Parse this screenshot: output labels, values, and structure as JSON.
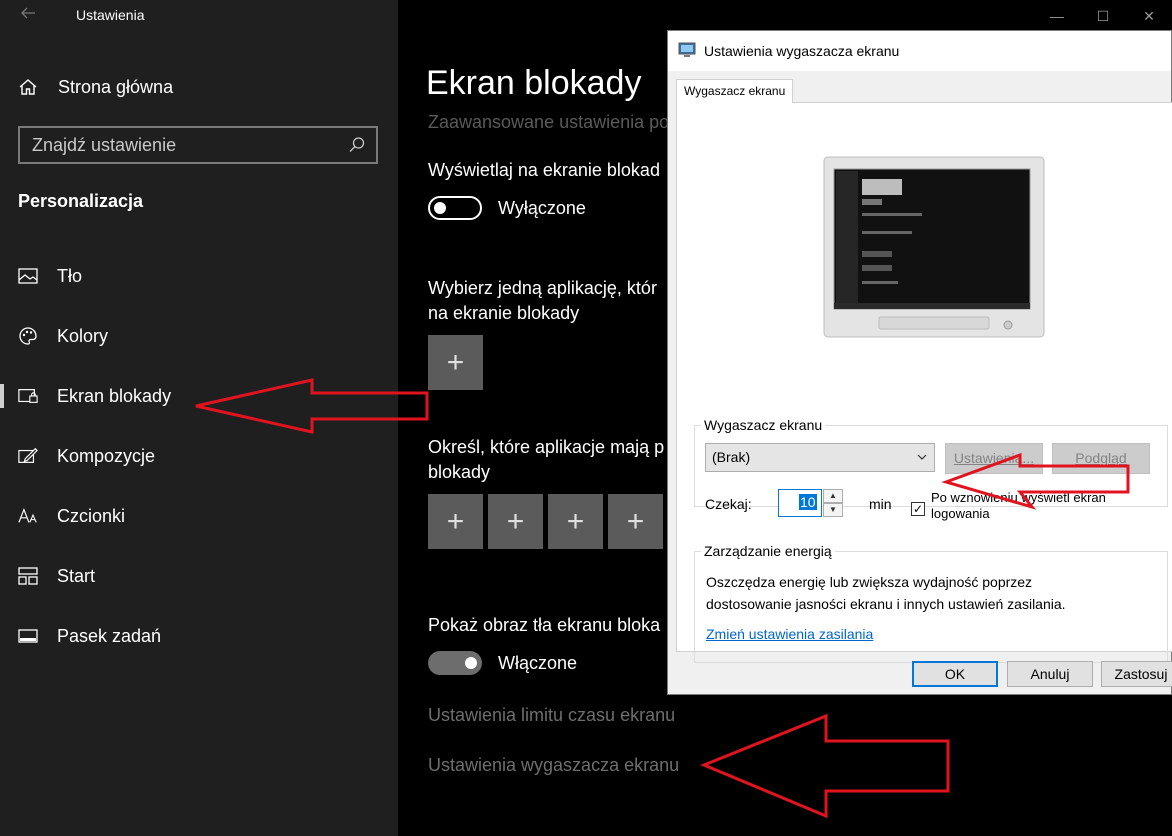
{
  "app": {
    "title": "Ustawienia"
  },
  "sidebar": {
    "home_label": "Strona główna",
    "search_placeholder": "Znajdź ustawienie",
    "section_title": "Personalizacja",
    "items": [
      {
        "label": "Tło",
        "icon": "image-icon"
      },
      {
        "label": "Kolory",
        "icon": "palette-icon"
      },
      {
        "label": "Ekran blokady",
        "icon": "lock-screen-icon",
        "active": true
      },
      {
        "label": "Kompozycje",
        "icon": "theme-brush-icon"
      },
      {
        "label": "Czcionki",
        "icon": "font-icon"
      },
      {
        "label": "Start",
        "icon": "start-icon"
      },
      {
        "label": "Pasek zadań",
        "icon": "taskbar-icon"
      }
    ]
  },
  "main": {
    "page_title": "Ekran blokady",
    "advanced_link": "Zaawansowane ustawienia po",
    "show_on_lock_label": "Wyświetlaj na ekranie blokad",
    "show_on_lock_state": "Wyłączone",
    "detailed_app_label_1": "Wybierz jedną aplikację, któr",
    "detailed_app_label_2": "na ekranie blokady",
    "quick_apps_label_1": "Określ, które aplikacje mają p",
    "quick_apps_label_2": "blokady",
    "plus_symbol": "+",
    "show_bg_label": "Pokaż obraz tła ekranu bloka",
    "show_bg_state": "Włączone",
    "timeout_link": "Ustawienia limitu czasu ekranu",
    "screensaver_link": "Ustawienia wygaszacza ekranu"
  },
  "dialog": {
    "title": "Ustawienia wygaszacza ekranu",
    "tab_label": "Wygaszacz ekranu",
    "screensaver_group_title": "Wygaszacz ekranu",
    "screensaver_value": "(Brak)",
    "settings_button": "Ustawienia...",
    "preview_button": "Podgląd",
    "wait_label": "Czekaj:",
    "wait_value": "10",
    "wait_unit": "min",
    "resume_checkbox_label_1": "Po wznowieniu wyświetl ekran",
    "resume_checkbox_label_2": "logowania",
    "resume_checked": true,
    "power_group_title": "Zarządzanie energią",
    "power_text_1": "Oszczędza energię lub zwiększa wydajność poprzez",
    "power_text_2": "dostosowanie jasności ekranu i innych ustawień zasilania.",
    "power_link": "Zmień ustawienia zasilania",
    "ok_button": "OK",
    "cancel_button": "Anuluj",
    "apply_button": "Zastosuj"
  },
  "colors": {
    "sidebar_bg": "#1f1f1f",
    "main_bg": "#000000",
    "accent": "#0078d7",
    "annotation_arrow": "#e0141e"
  }
}
